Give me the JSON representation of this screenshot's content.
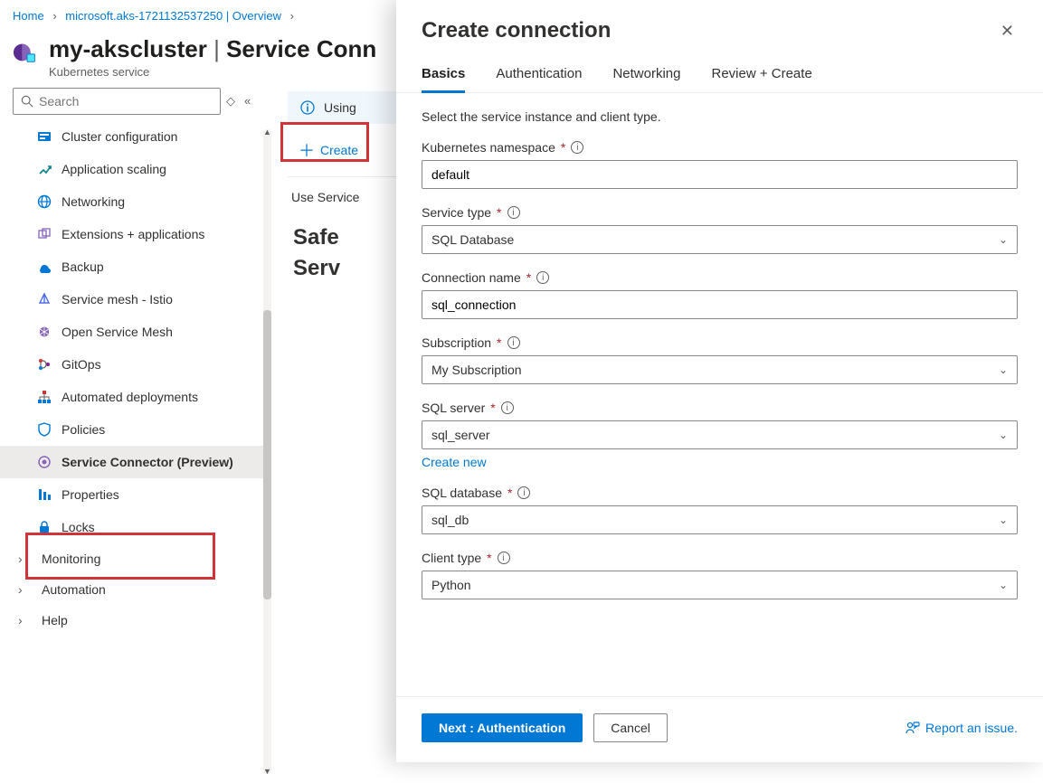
{
  "breadcrumb": {
    "home": "Home",
    "rg": "microsoft.aks-1721132537250 | Overview"
  },
  "header": {
    "cluster_name": "my-akscluster",
    "section": "Service Conn",
    "pipe": " | ",
    "subtitle": "Kubernetes service"
  },
  "search": {
    "placeholder": "Search"
  },
  "sidebar": {
    "items": [
      {
        "label": "Cluster configuration"
      },
      {
        "label": "Application scaling"
      },
      {
        "label": "Networking"
      },
      {
        "label": "Extensions + applications"
      },
      {
        "label": "Backup"
      },
      {
        "label": "Service mesh - Istio"
      },
      {
        "label": "Open Service Mesh"
      },
      {
        "label": "GitOps"
      },
      {
        "label": "Automated deployments"
      },
      {
        "label": "Policies"
      },
      {
        "label": "Service Connector (Preview)"
      },
      {
        "label": "Properties"
      },
      {
        "label": "Locks"
      }
    ],
    "groups": [
      {
        "label": "Monitoring"
      },
      {
        "label": "Automation"
      },
      {
        "label": "Help"
      }
    ]
  },
  "main": {
    "info": "Using",
    "create_label": "Create",
    "use_text": "Use Service",
    "page_heading_line1": "Safe",
    "page_heading_line2": "Serv"
  },
  "panel": {
    "title": "Create connection",
    "tabs": [
      "Basics",
      "Authentication",
      "Networking",
      "Review + Create"
    ],
    "hint": "Select the service instance and client type.",
    "labels": {
      "namespace": "Kubernetes namespace",
      "service_type": "Service type",
      "connection_name": "Connection name",
      "subscription": "Subscription",
      "sql_server": "SQL server",
      "sql_database": "SQL database",
      "client_type": "Client type"
    },
    "values": {
      "namespace": "default",
      "service_type": "SQL Database",
      "connection_name": "sql_connection",
      "subscription": "My Subscription",
      "sql_server": "sql_server",
      "sql_database": "sql_db",
      "client_type": "Python"
    },
    "create_new": "Create new",
    "footer": {
      "next": "Next : Authentication",
      "cancel": "Cancel",
      "report": "Report an issue."
    }
  }
}
